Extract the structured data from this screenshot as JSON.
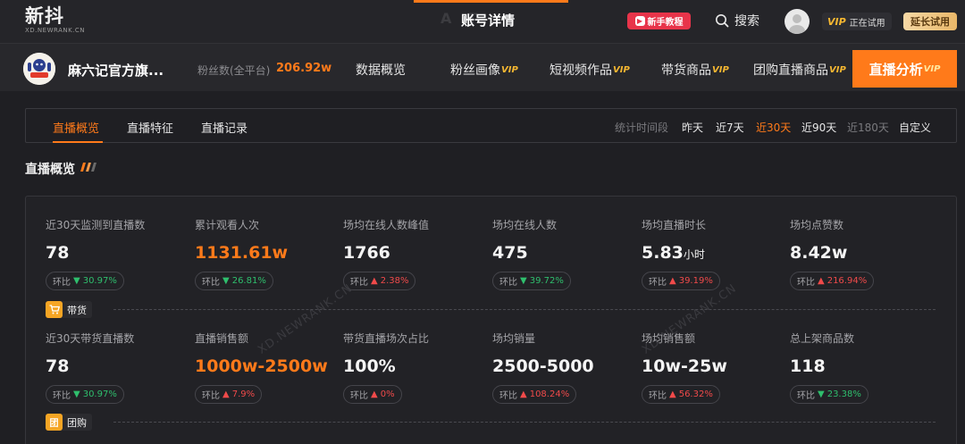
{
  "topbar": {
    "logo_main": "新抖",
    "logo_sub": "XD.NEWRANK.CN",
    "watermark_text": "A        T",
    "center_title": "账号详情",
    "tutorial_label": "新手教程",
    "search_label": "搜索",
    "vip_label": "VIP",
    "vip_status": "正在试用",
    "extend_label": "延长试用"
  },
  "account": {
    "name": "麻六记官方旗...",
    "fans_label": "粉丝数(全平台)",
    "fans_value": "206.92w"
  },
  "nav": {
    "items": [
      {
        "label": "数据概览",
        "vip": ""
      },
      {
        "label": "粉丝画像",
        "vip": "VIP"
      },
      {
        "label": "短视频作品",
        "vip": "VIP"
      },
      {
        "label": "带货商品",
        "vip": "VIP"
      },
      {
        "label": "团购直播商品",
        "vip": "VIP"
      }
    ],
    "active": {
      "label": "直播分析",
      "vip": "VIP"
    }
  },
  "subtabs": {
    "items": [
      "直播概览",
      "直播特征",
      "直播记录"
    ],
    "active_index": 0,
    "period_label": "统计时间段",
    "periods": [
      "昨天",
      "近7天",
      "近30天",
      "近90天",
      "近180天",
      "自定义"
    ],
    "active_period": "近30天"
  },
  "section": {
    "title": "直播概览"
  },
  "stats_row1": [
    {
      "label": "近30天监测到直播数",
      "value": "78",
      "unit": "",
      "chip_label": "环比",
      "dir": "down",
      "change": "30.97%"
    },
    {
      "label": "累计观看人次",
      "value": "1131.61w",
      "unit": "",
      "chip_label": "环比",
      "dir": "down",
      "change": "26.81%"
    },
    {
      "label": "场均在线人数峰值",
      "value": "1766",
      "unit": "",
      "chip_label": "环比",
      "dir": "up",
      "change": "2.38%"
    },
    {
      "label": "场均在线人数",
      "value": "475",
      "unit": "",
      "chip_label": "环比",
      "dir": "down",
      "change": "39.72%"
    },
    {
      "label": "场均直播时长",
      "value": "5.83",
      "unit": "小时",
      "chip_label": "环比",
      "dir": "up",
      "change": "39.19%"
    },
    {
      "label": "场均点赞数",
      "value": "8.42w",
      "unit": "",
      "chip_label": "环比",
      "dir": "up",
      "change": "216.94%"
    }
  ],
  "group_daihuo": {
    "label": "带货"
  },
  "stats_row2": [
    {
      "label": "近30天带货直播数",
      "value": "78",
      "unit": "",
      "chip_label": "环比",
      "dir": "down",
      "change": "30.97%"
    },
    {
      "label": "直播销售额",
      "value": "1000w-2500w",
      "unit": "",
      "chip_label": "环比",
      "dir": "up",
      "change": "7.9%"
    },
    {
      "label": "带货直播场次占比",
      "value": "100%",
      "unit": "",
      "chip_label": "环比",
      "dir": "up",
      "change": "0%"
    },
    {
      "label": "场均销量",
      "value": "2500-5000",
      "unit": "",
      "chip_label": "环比",
      "dir": "up",
      "change": "108.24%"
    },
    {
      "label": "场均销售额",
      "value": "10w-25w",
      "unit": "",
      "chip_label": "环比",
      "dir": "up",
      "change": "56.32%"
    },
    {
      "label": "总上架商品数",
      "value": "118",
      "unit": "",
      "chip_label": "环比",
      "dir": "down",
      "change": "23.38%"
    }
  ],
  "group_tuangou": {
    "label": "团购"
  },
  "watermark": "XD.NEWRANK.CN",
  "colors": {
    "accent": "#ff7a1a",
    "up": "#f04a4a",
    "down": "#2fbf6d",
    "background": "#1f1f23"
  }
}
